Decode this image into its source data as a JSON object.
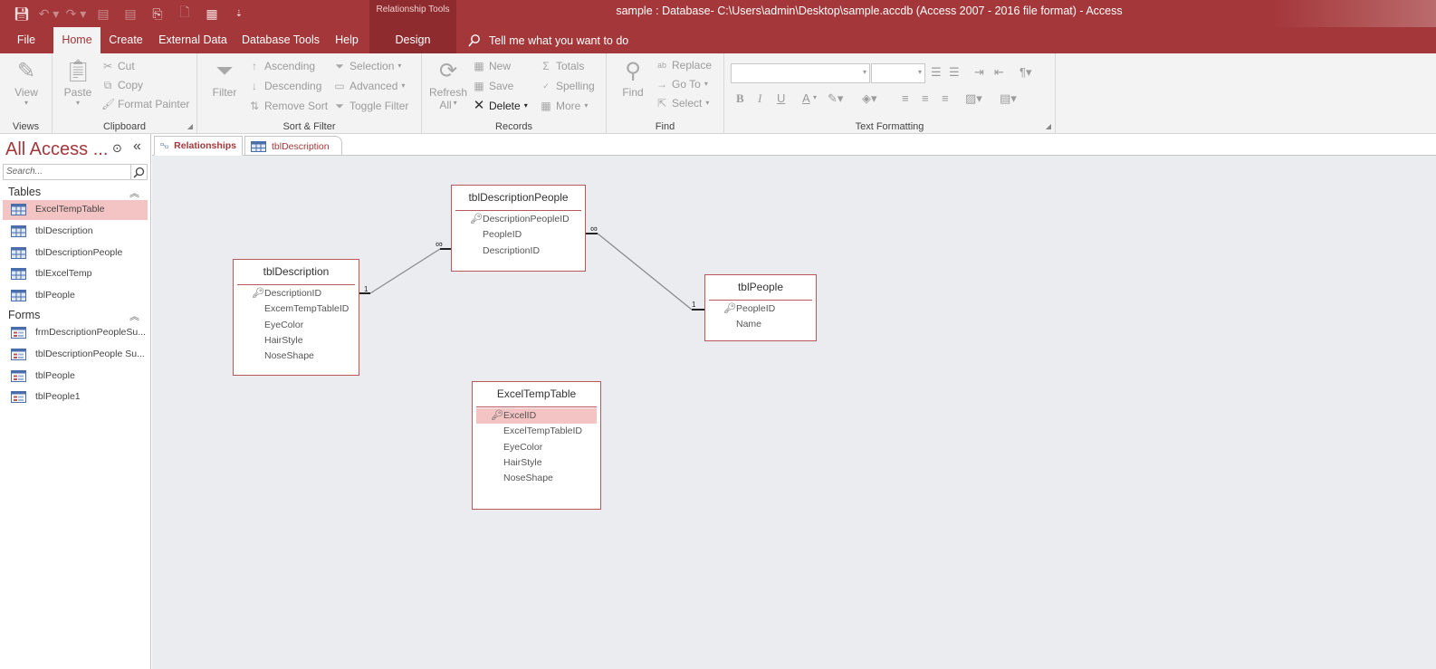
{
  "window": {
    "title": "sample : Database- C:\\Users\\admin\\Desktop\\sample.accdb (Access 2007 - 2016 file format)  -  Access",
    "context_group": "Relationship Tools",
    "accent": "#a4373a"
  },
  "qat": {
    "icons": [
      "save-icon",
      "undo-icon",
      "redo-icon",
      "table-view-icon",
      "table-view-icon",
      "relationships-icon",
      "print-preview-icon",
      "table-design-icon",
      "customize-qat-icon"
    ]
  },
  "ribbon_tabs": {
    "file": "File",
    "home": "Home",
    "create": "Create",
    "external_data": "External Data",
    "database_tools": "Database Tools",
    "help": "Help",
    "design": "Design",
    "tell_me": "Tell me what you want to do"
  },
  "ribbon": {
    "views": {
      "label": "Views",
      "view": "View"
    },
    "clipboard": {
      "label": "Clipboard",
      "paste": "Paste",
      "cut": "Cut",
      "copy": "Copy",
      "format_painter": "Format Painter"
    },
    "sort_filter": {
      "label": "Sort & Filter",
      "filter": "Filter",
      "ascending": "Ascending",
      "descending": "Descending",
      "remove_sort": "Remove Sort",
      "selection": "Selection",
      "advanced": "Advanced",
      "toggle_filter": "Toggle Filter"
    },
    "records": {
      "label": "Records",
      "refresh": "Refresh",
      "refresh_all": "All",
      "new": "New",
      "save": "Save",
      "delete": "Delete",
      "totals": "Totals",
      "spelling": "Spelling",
      "more": "More"
    },
    "find": {
      "label": "Find",
      "find": "Find",
      "replace": "Replace",
      "go_to": "Go To",
      "select": "Select"
    },
    "text_formatting": {
      "label": "Text Formatting",
      "bold": "B",
      "italic": "I",
      "underline": "U",
      "font_color": "A"
    }
  },
  "nav": {
    "title": "All Access ...",
    "search_placeholder": "Search...",
    "sections": {
      "tables": {
        "label": "Tables",
        "items": [
          "ExcelTempTable",
          "tblDescription",
          "tblDescriptionPeople",
          "tblExcelTemp",
          "tblPeople"
        ]
      },
      "forms": {
        "label": "Forms",
        "items": [
          "frmDescriptionPeopleSu...",
          "tblDescriptionPeople Su...",
          "tblPeople",
          "tblPeople1"
        ]
      }
    },
    "selected_item": "ExcelTempTable"
  },
  "doc_tabs": {
    "relationships": "Relationships",
    "tbl_description": "tblDescription"
  },
  "tables": {
    "tblDescriptionPeople": {
      "name": "tblDescriptionPeople",
      "fields": [
        "DescriptionPeopleID",
        "PeopleID",
        "DescriptionID"
      ],
      "key_field": "DescriptionPeopleID"
    },
    "tblDescription": {
      "name": "tblDescription",
      "fields": [
        "DescriptionID",
        "ExcemTempTableID",
        "EyeColor",
        "HairStyle",
        "NoseShape"
      ],
      "key_field": "DescriptionID"
    },
    "tblPeople": {
      "name": "tblPeople",
      "fields": [
        "PeopleID",
        "Name"
      ],
      "key_field": "PeopleID"
    },
    "ExcelTempTable": {
      "name": "ExcelTempTable",
      "fields": [
        "ExcelID",
        "ExcelTempTableID",
        "EyeColor",
        "HairStyle",
        "NoseShape"
      ],
      "key_field": "ExcelID",
      "selected_field": "ExcelID"
    }
  },
  "relationships": [
    {
      "from": "tblDescription",
      "to": "tblDescriptionPeople",
      "one": "1",
      "many": "∞"
    },
    {
      "from": "tblPeople",
      "to": "tblDescriptionPeople",
      "one": "1",
      "many": "∞"
    }
  ]
}
